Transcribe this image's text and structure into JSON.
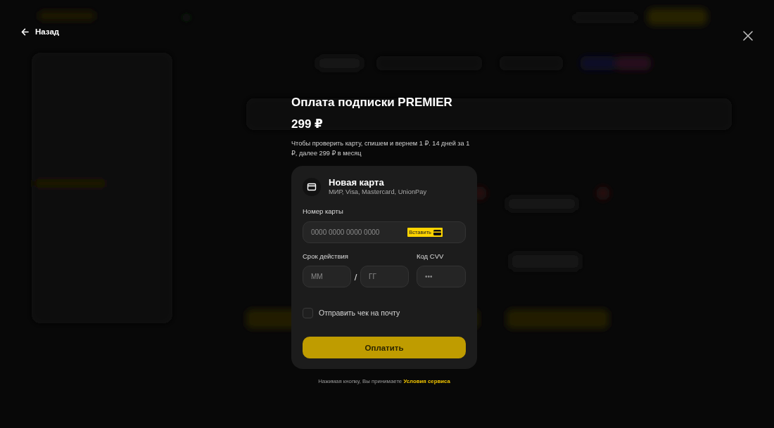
{
  "back_link": {
    "label": "Назад"
  },
  "payment": {
    "title": "Оплата подписки PREMIER",
    "price": "299 ₽",
    "description": "Чтобы проверить карту, спишем и вернем 1 ₽. 14 дней за 1 ₽, далее 299 ₽ в месяц"
  },
  "card_form": {
    "title": "Новая карта",
    "subtitle": "МИР, Visa, Mastercard, UnionPay",
    "card_number": {
      "label": "Номер карты",
      "placeholder": "0000 0000 0000 0000",
      "paste_button": "Вставить"
    },
    "expiry": {
      "label": "Срок действия",
      "month_placeholder": "ММ",
      "separator": "/",
      "year_placeholder": "ГГ"
    },
    "cvv": {
      "label": "Код CVV",
      "placeholder": "•••"
    },
    "receipt_checkbox": {
      "label": "Отправить чек на почту",
      "checked": false
    },
    "pay_button": "Оплатить"
  },
  "terms": {
    "text": "Нажимая кнопку, Вы принимаете",
    "link": "Условия сервиса"
  }
}
